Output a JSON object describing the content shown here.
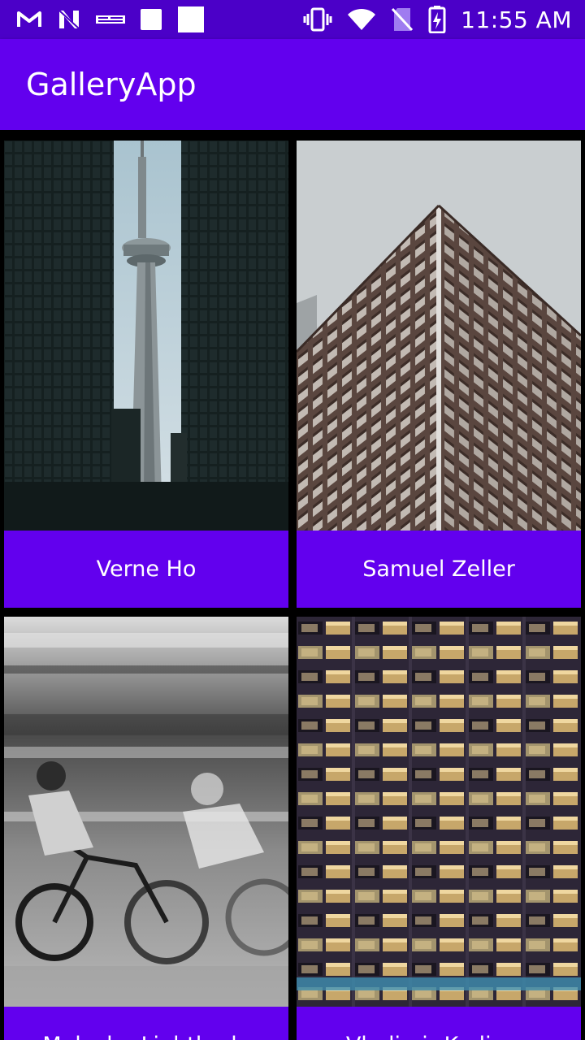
{
  "status_bar": {
    "time": "11:55 AM",
    "left_icons": [
      "gmail-icon",
      "n-icon",
      "news-icon",
      "square-icon",
      "square-icon"
    ],
    "right_icons": [
      "vibrate-icon",
      "wifi-icon",
      "no-sim-icon",
      "battery-charging-icon"
    ]
  },
  "app_bar": {
    "title": "GalleryApp"
  },
  "gallery": {
    "items": [
      {
        "author": "Verne Ho",
        "image": "cn-tower-between-dark-skyscrapers"
      },
      {
        "author": "Samuel Zeller",
        "image": "building-corner-facade-looking-up"
      },
      {
        "author": "Malcolm Lightbody",
        "image": "blurred-cyclists-black-and-white"
      },
      {
        "author": "Vladimir Kudinov",
        "image": "office-building-windows-at-night"
      }
    ]
  },
  "colors": {
    "primary": "#6200ee",
    "primary_dark": "#4b00c8",
    "background": "#000000",
    "text_on_primary": "#ffffff"
  }
}
